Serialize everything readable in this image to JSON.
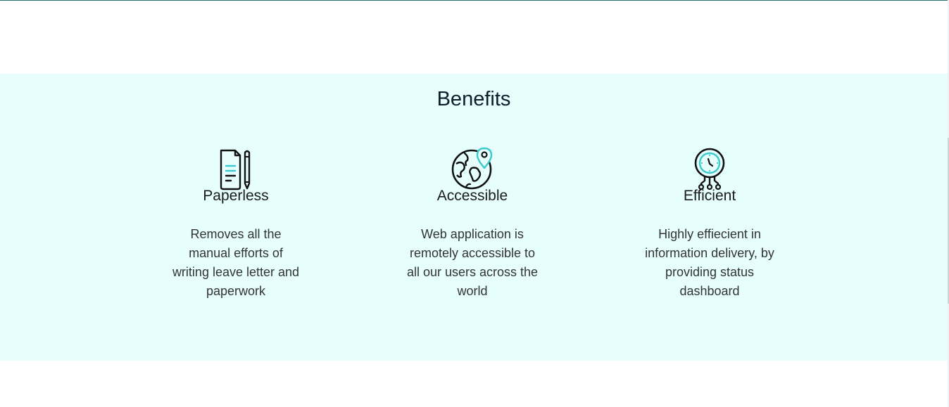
{
  "benefits": {
    "title": "Benefits",
    "items": [
      {
        "icon": "document-pencil-icon",
        "title": "Paperless",
        "description": "Removes all the manual efforts of writing leave letter and paperwork"
      },
      {
        "icon": "globe-location-icon",
        "title": "Accessible",
        "description": "Web application is remotely accessible to all our users across the world"
      },
      {
        "icon": "clock-circuit-icon",
        "title": "Efficient",
        "description": "Highly effiecient in information delivery, by providing status dashboard"
      }
    ]
  },
  "colors": {
    "section_background": "#e6fffd",
    "accent": "#3cc9cf",
    "icon_stroke": "#111111",
    "heading": "#0e1c2c",
    "text": "#333333"
  }
}
